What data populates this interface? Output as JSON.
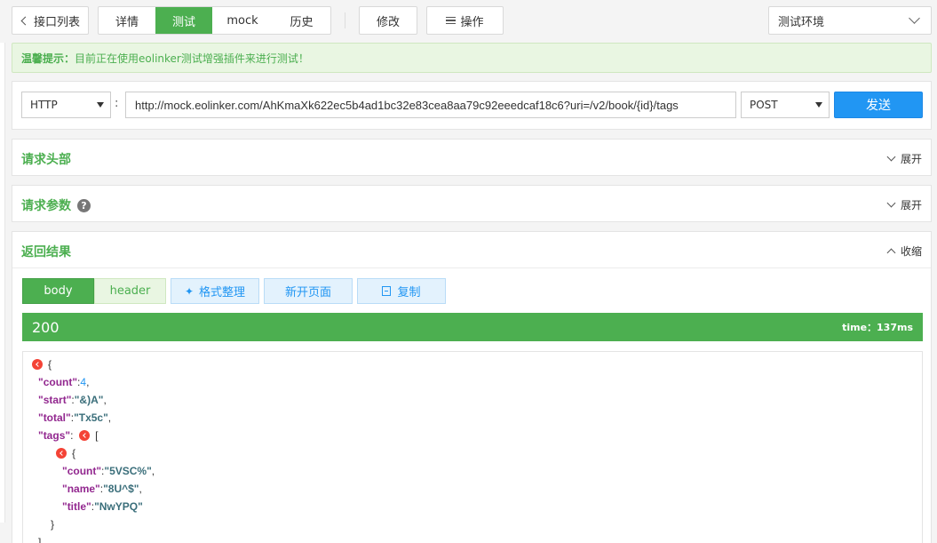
{
  "toolbar": {
    "back_label": "接口列表",
    "tabs": [
      {
        "label": "详情"
      },
      {
        "label": "测试"
      },
      {
        "label": "mock"
      },
      {
        "label": "历史"
      }
    ],
    "edit_label": "修改",
    "ops_label": "操作",
    "environment": "测试环境"
  },
  "tip": {
    "prefix": "温馨提示：",
    "text": "目前正在使用eolinker测试增强插件来进行测试！"
  },
  "request": {
    "protocol": "HTTP",
    "separator": ":",
    "url": "http://mock.eolinker.com/AhKmaXk622ec5b4ad1bc32e83cea8aa79c92eeedcaf18c6?uri=/v2/book/{id}/tags",
    "method": "POST",
    "send_label": "发送"
  },
  "sections": {
    "headers": {
      "title": "请求头部",
      "toggle": "展开"
    },
    "params": {
      "title": "请求参数",
      "help": "?",
      "toggle": "展开"
    },
    "result": {
      "title": "返回结果",
      "toggle": "收缩"
    }
  },
  "result": {
    "tabs": {
      "body": "body",
      "header": "header"
    },
    "tools": {
      "format": "格式整理",
      "newpage": "新开页面",
      "copy": "复制"
    },
    "status_code": "200",
    "time": "time：137ms",
    "json": {
      "open_brace": "{",
      "count_key": "\"count\"",
      "count_val": "4",
      "start_key": "\"start\"",
      "start_val": "\"&)A\"",
      "total_key": "\"total\"",
      "total_val": "\"Tx5c\"",
      "tags_key": "\"tags\"",
      "open_bracket": "[",
      "item_open": "{",
      "item_count_key": "\"count\"",
      "item_count_val": "\"5VSC%\"",
      "item_name_key": "\"name\"",
      "item_name_val": "\"8U^$\"",
      "item_title_key": "\"title\"",
      "item_title_val": "\"NwYPQ\"",
      "item_close": "}",
      "close_bracket": "]"
    }
  }
}
